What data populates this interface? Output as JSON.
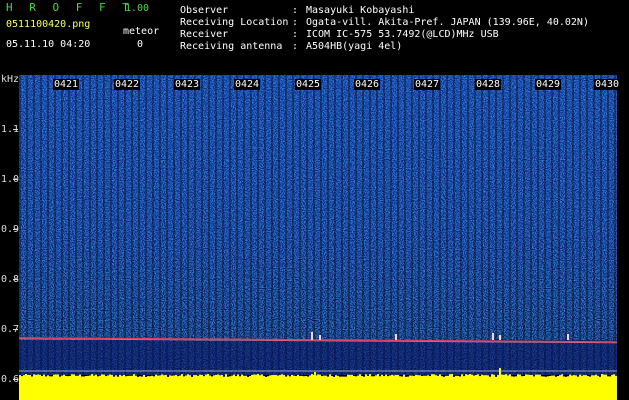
{
  "header": {
    "app_title": "H R O F F T",
    "app_version": "1.00",
    "file_name": "0511100420.png",
    "timestamp": "05.11.10 04:20",
    "meteor_label": "meteor",
    "meteor_count": "0"
  },
  "station_info": [
    {
      "label": "Observer",
      "value": "Masayuki Kobayashi"
    },
    {
      "label": "Receiving Location",
      "value": "Ogata-vill. Akita-Pref. JAPAN (139.96E, 40.02N)"
    },
    {
      "label": "Receiver",
      "value": "ICOM IC-575 53.7492(@LCD)MHz USB"
    },
    {
      "label": "Receiving antenna",
      "value": "A504HB(yagi 4el)"
    }
  ],
  "separator": ":",
  "axis": {
    "unit": "kHz",
    "freq_ticks": [
      "1.1",
      "1.0",
      "0.9",
      "0.8",
      "0.7",
      "0.6"
    ],
    "time_labels": [
      "0421",
      "0422",
      "0423",
      "0424",
      "0425",
      "0426",
      "0427",
      "0428",
      "0429",
      "0430"
    ]
  },
  "colors": {
    "background": "#000000",
    "spectrum_low": "#0a1a8a",
    "spectrum_high": "#19d6c8",
    "carrier_line": "#e04060",
    "level_bar": "#ffff00",
    "title_green": "#3ddc3d",
    "filename_yellow": "#ffff66"
  }
}
